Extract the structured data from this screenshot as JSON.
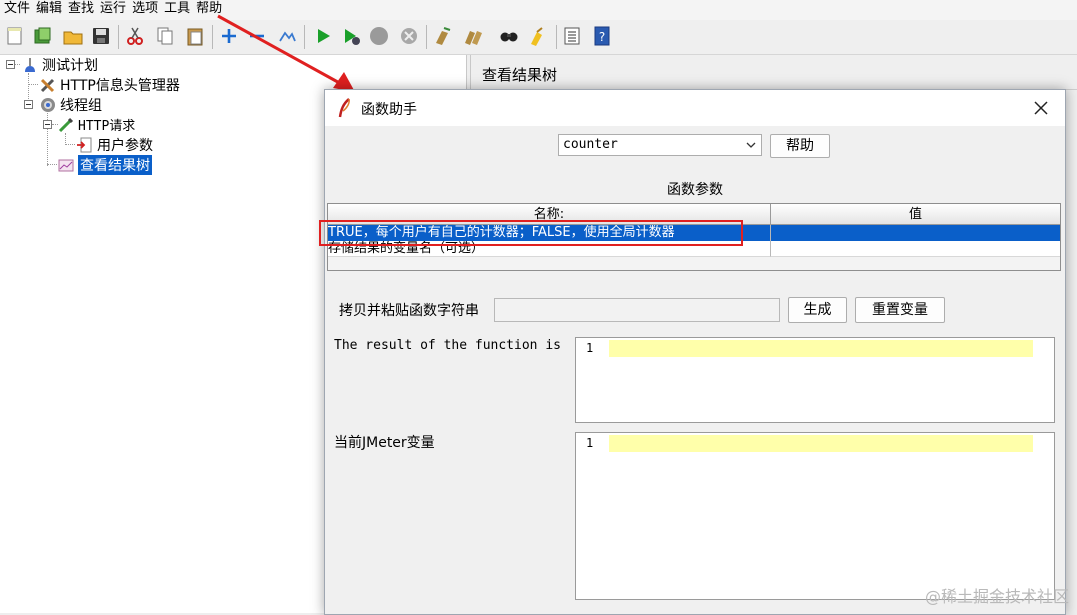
{
  "menubar": {
    "items": [
      "文件",
      "编辑",
      "查找",
      "运行",
      "选项",
      "工具",
      "帮助"
    ]
  },
  "toolbar": {
    "icons": [
      "new-icon",
      "templates-icon",
      "open-icon",
      "save-icon",
      "cut-icon",
      "copy-icon",
      "paste-icon",
      "expand-icon",
      "collapse-icon",
      "toggle-icon",
      "start-icon",
      "start-no-pause-icon",
      "stop-icon",
      "shutdown-icon",
      "clear-icon",
      "clear-all-icon",
      "search-icon",
      "reset-search-icon",
      "function-helper-icon",
      "help-icon"
    ]
  },
  "tree": {
    "items": [
      {
        "label": "测试计划"
      },
      {
        "label": "HTTP信息头管理器"
      },
      {
        "label": "线程组"
      },
      {
        "label": "HTTP请求"
      },
      {
        "label": "用户参数"
      },
      {
        "label": "查看结果树"
      }
    ]
  },
  "right_panel": {
    "title": "查看结果树"
  },
  "dialog": {
    "title": "函数助手",
    "function_select": {
      "value": "counter"
    },
    "help_button": "帮助",
    "params_title": "函数参数",
    "table": {
      "headers": [
        "名称:",
        "值"
      ],
      "rows": [
        {
          "name": "TRUE，每个用户有自己的计数器；FALSE，使用全局计数器",
          "value": ""
        },
        {
          "name": "存储结果的变量名（可选）",
          "value": ""
        }
      ]
    },
    "copy_label": "拷贝并粘贴函数字符串",
    "copy_value": "",
    "generate_button": "生成",
    "reset_button": "重置变量",
    "result_label": "The result of the function is",
    "result_line_number": "1",
    "vars_label": "当前JMeter变量",
    "vars_line_number": "1"
  },
  "watermark": "@稀土掘金技术社区",
  "colors": {
    "selection": "#0a5fc9",
    "highlight_box": "#e02020",
    "editor_line": "#ffffaa",
    "arrow": "#e02020"
  }
}
